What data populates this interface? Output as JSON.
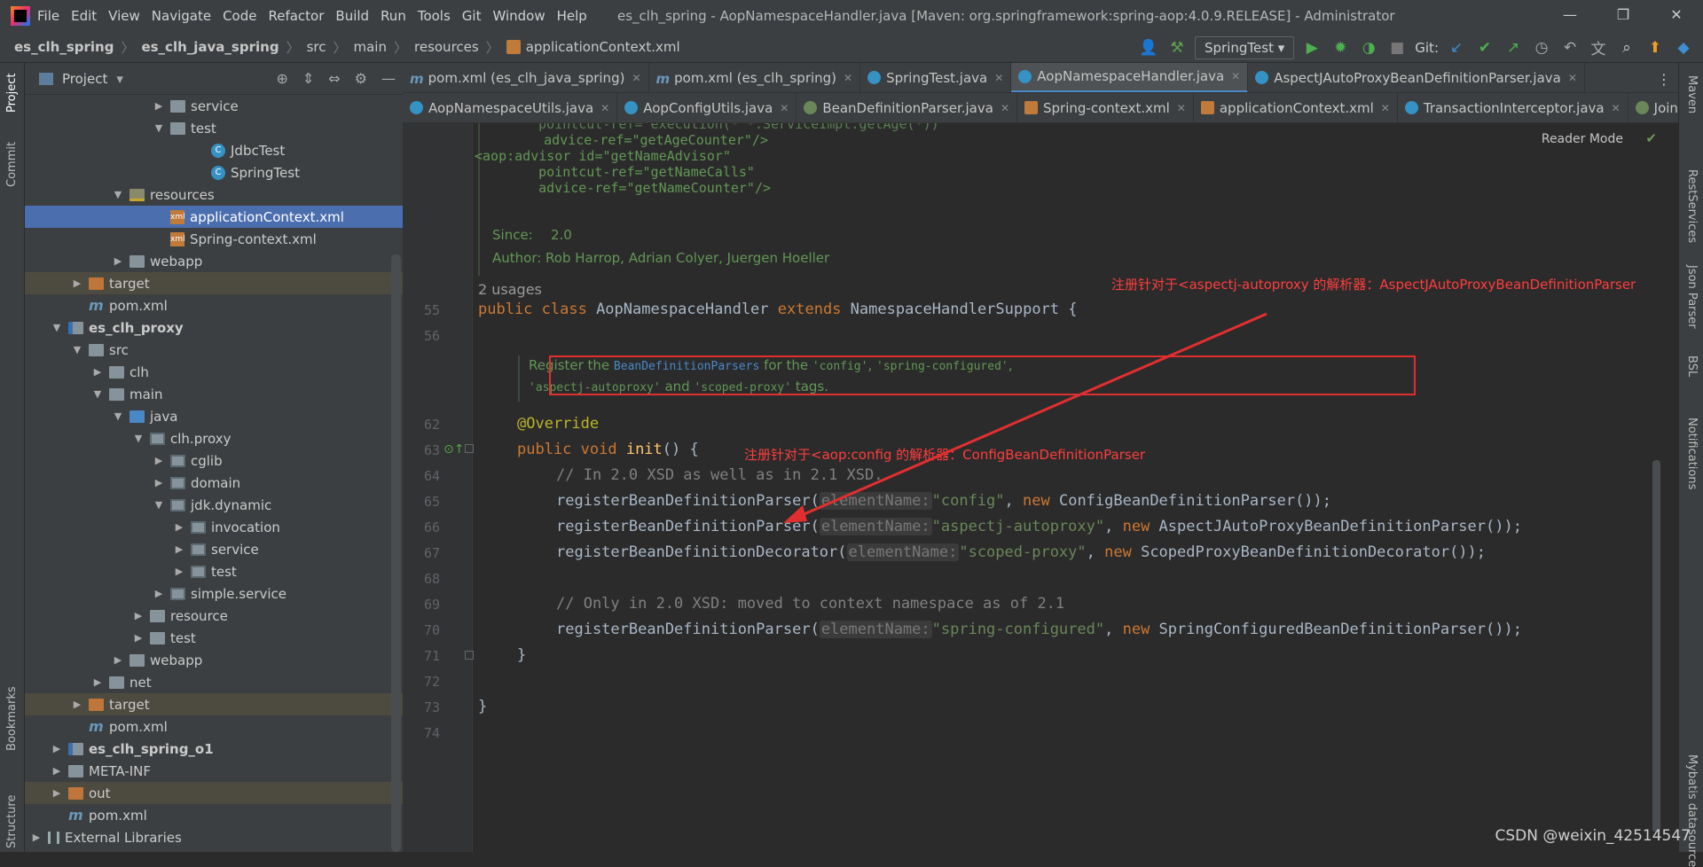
{
  "app": {
    "menu": [
      "File",
      "Edit",
      "View",
      "Navigate",
      "Code",
      "Refactor",
      "Build",
      "Run",
      "Tools",
      "Git",
      "Window",
      "Help"
    ],
    "title": "es_clh_spring - AopNamespaceHandler.java [Maven: org.springframework:spring-aop:4.0.9.RELEASE] - Administrator"
  },
  "breadcrumb": [
    "es_clh_spring",
    "es_clh_java_spring",
    "src",
    "main",
    "resources",
    "applicationContext.xml"
  ],
  "toolbar": {
    "run_config": "SpringTest",
    "git_label": "Git:"
  },
  "left_strip": {
    "project": "Project",
    "commit": "Commit",
    "bookmarks": "Bookmarks",
    "structure": "Structure"
  },
  "right_strip": {
    "maven": "Maven",
    "rest": "RestServices",
    "json": "Json Parser",
    "bsl": "BSL",
    "notif": "Notifications",
    "mybatis": "Mybatis datasource"
  },
  "project": {
    "header": "Project",
    "rows": [
      {
        "label": "service",
        "indent": 6,
        "arrow": "›",
        "icon": "dir"
      },
      {
        "label": "test",
        "indent": 6,
        "arrow": "⌄",
        "icon": "dir"
      },
      {
        "label": "JdbcTest",
        "indent": 8,
        "arrow": "",
        "icon": "class"
      },
      {
        "label": "SpringTest",
        "indent": 8,
        "arrow": "",
        "icon": "class"
      },
      {
        "label": "resources",
        "indent": 4,
        "arrow": "⌄",
        "icon": "res"
      },
      {
        "label": "applicationContext.xml",
        "indent": 6,
        "arrow": "",
        "icon": "xml",
        "sel": true
      },
      {
        "label": "Spring-context.xml",
        "indent": 6,
        "arrow": "",
        "icon": "xml"
      },
      {
        "label": "webapp",
        "indent": 4,
        "arrow": "›",
        "icon": "dir"
      },
      {
        "label": "target",
        "indent": 2,
        "arrow": "›",
        "icon": "tgt",
        "hl": true
      },
      {
        "label": "pom.xml",
        "indent": 2,
        "arrow": "",
        "icon": "maven"
      },
      {
        "label": "es_clh_proxy",
        "indent": 1,
        "arrow": "⌄",
        "icon": "mod",
        "bold": true
      },
      {
        "label": "src",
        "indent": 2,
        "arrow": "⌄",
        "icon": "dir"
      },
      {
        "label": "clh",
        "indent": 3,
        "arrow": "›",
        "icon": "dir"
      },
      {
        "label": "main",
        "indent": 3,
        "arrow": "⌄",
        "icon": "dir"
      },
      {
        "label": "java",
        "indent": 4,
        "arrow": "⌄",
        "icon": "src"
      },
      {
        "label": "clh.proxy",
        "indent": 5,
        "arrow": "⌄",
        "icon": "pkg"
      },
      {
        "label": "cglib",
        "indent": 6,
        "arrow": "›",
        "icon": "pkg"
      },
      {
        "label": "domain",
        "indent": 6,
        "arrow": "›",
        "icon": "pkg"
      },
      {
        "label": "jdk.dynamic",
        "indent": 6,
        "arrow": "⌄",
        "icon": "pkg"
      },
      {
        "label": "invocation",
        "indent": 7,
        "arrow": "›",
        "icon": "pkg"
      },
      {
        "label": "service",
        "indent": 7,
        "arrow": "›",
        "icon": "pkg"
      },
      {
        "label": "test",
        "indent": 7,
        "arrow": "›",
        "icon": "pkg"
      },
      {
        "label": "simple.service",
        "indent": 6,
        "arrow": "›",
        "icon": "pkg"
      },
      {
        "label": "resource",
        "indent": 5,
        "arrow": "›",
        "icon": "dir"
      },
      {
        "label": "test",
        "indent": 5,
        "arrow": "›",
        "icon": "dir"
      },
      {
        "label": "webapp",
        "indent": 4,
        "arrow": "›",
        "icon": "dir"
      },
      {
        "label": "net",
        "indent": 3,
        "arrow": "›",
        "icon": "dir"
      },
      {
        "label": "target",
        "indent": 2,
        "arrow": "›",
        "icon": "tgt",
        "hl": true
      },
      {
        "label": "pom.xml",
        "indent": 2,
        "arrow": "",
        "icon": "maven"
      },
      {
        "label": "es_clh_spring_o1",
        "indent": 1,
        "arrow": "›",
        "icon": "mod",
        "bold": true
      },
      {
        "label": "META-INF",
        "indent": 1,
        "arrow": "›",
        "icon": "dir"
      },
      {
        "label": "out",
        "indent": 1,
        "arrow": "›",
        "icon": "tgt",
        "hl": true
      },
      {
        "label": "pom.xml",
        "indent": 1,
        "arrow": "",
        "icon": "maven"
      },
      {
        "label": "External Libraries",
        "indent": 0,
        "arrow": "›",
        "icon": "lib"
      }
    ]
  },
  "tabs_row1": [
    {
      "label": "pom.xml (es_clh_java_spring)",
      "icon": "m"
    },
    {
      "label": "pom.xml (es_clh_spring)",
      "icon": "m"
    },
    {
      "label": "SpringTest.java",
      "icon": "c"
    },
    {
      "label": "AopNamespaceHandler.java",
      "icon": "c",
      "active": true
    },
    {
      "label": "AspectJAutoProxyBeanDefinitionParser.java",
      "icon": "c"
    }
  ],
  "tabs_row2": [
    {
      "label": "AopNamespaceUtils.java",
      "icon": "c"
    },
    {
      "label": "AopConfigUtils.java",
      "icon": "c"
    },
    {
      "label": "BeanDefinitionParser.java",
      "icon": "i"
    },
    {
      "label": "Spring-context.xml",
      "icon": "x"
    },
    {
      "label": "applicationContext.xml",
      "icon": "x"
    },
    {
      "label": "TransactionInterceptor.java",
      "icon": "c"
    },
    {
      "label": "Joinpoint.class",
      "icon": "i"
    }
  ],
  "editor": {
    "reader_mode": "Reader Mode",
    "doc_top_xml": [
      "    pointcut-ref=\"execution(* *.ServiceImpl.getAge(*))\"",
      "    advice-ref=\"getAgeCounter\"/>",
      "",
      "<aop:advisor id=\"getNameAdvisor\"",
      "    pointcut-ref=\"getNameCalls\"",
      "    advice-ref=\"getNameCounter\"/>"
    ],
    "since_label": "Since:",
    "since_value": "2.0",
    "author": "Author: Rob Harrop, Adrian Colyer, Juergen Hoeller",
    "usages": "2 usages",
    "doc2": {
      "p1": "Register the ",
      "ref": "BeanDefinitionParsers",
      "p2": " for the ",
      "c1": "'config'",
      "p3": ", ",
      "c2": "'spring-configured'",
      "p4": ",",
      "c3": "'aspectj-autoproxy'",
      "p5": " and ",
      "c4": "'scoped-proxy'",
      "p6": " tags."
    },
    "line_numbers": [
      "55",
      "56",
      "62",
      "63",
      "64",
      "65",
      "66",
      "67",
      "68",
      "69",
      "70",
      "71",
      "72",
      "73",
      "74"
    ],
    "code": {
      "l55_kw1": "public class ",
      "l55_name": "AopNamespaceHandler ",
      "l55_kw2": "extends ",
      "l55_rest": "NamespaceHandlerSupport {",
      "l62": "@Override",
      "l63_kw": "public void ",
      "l63_fn": "init",
      "l63_rest": "() {",
      "l64": "// In 2.0 XSD as well as in 2.1 XSD.",
      "l65_a": "registerBeanDefinitionParser(",
      "l65_hint": "elementName:",
      "l65_str": "\"config\"",
      "l65_b": ", ",
      "l65_kw": "new ",
      "l65_c": "ConfigBeanDefinitionParser());",
      "l66_a": "registerBeanDefinitionParser(",
      "l66_hint": "elementName:",
      "l66_str": "\"aspectj-autoproxy\"",
      "l66_b": ", ",
      "l66_kw": "new ",
      "l66_c": "AspectJAutoProxyBeanDefinitionParser());",
      "l67_a": "registerBeanDefinitionDecorator(",
      "l67_hint": "elementName:",
      "l67_str": "\"scoped-proxy\"",
      "l67_b": ", ",
      "l67_kw": "new ",
      "l67_c": "ScopedProxyBeanDefinitionDecorator());",
      "l69": "// Only in 2.0 XSD: moved to context namespace as of 2.1",
      "l70_a": "registerBeanDefinitionParser(",
      "l70_hint": "elementName:",
      "l70_str": "\"spring-configured\"",
      "l70_b": ", ",
      "l70_kw": "new ",
      "l70_c": "SpringConfiguredBeanDefinitionParser());",
      "l71": "}",
      "l73": "}"
    }
  },
  "annotations": {
    "top": "注册针对于<aspectj-autoproxy 的解析器：AspectJAutoProxyBeanDefinitionParser",
    "mid": "注册针对于<aop:config 的解析器：ConfigBeanDefinitionParser"
  },
  "watermark": "CSDN @weixin_42514547"
}
